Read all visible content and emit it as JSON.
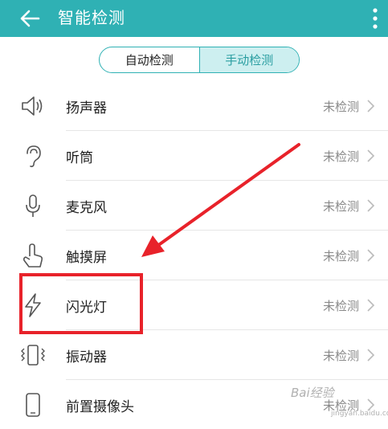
{
  "header": {
    "title": "智能检测",
    "bg_color": "#2fb1b4"
  },
  "segment": {
    "auto": "自动检测",
    "manual": "手动检测",
    "active": "manual"
  },
  "items": [
    {
      "label": "扬声器",
      "status": "未检测",
      "icon": "speaker-icon"
    },
    {
      "label": "听筒",
      "status": "未检测",
      "icon": "ear-icon"
    },
    {
      "label": "麦克风",
      "status": "未检测",
      "icon": "microphone-icon"
    },
    {
      "label": "触摸屏",
      "status": "未检测",
      "icon": "touch-icon"
    },
    {
      "label": "闪光灯",
      "status": "未检测",
      "icon": "flash-icon"
    },
    {
      "label": "振动器",
      "status": "未检测",
      "icon": "vibration-icon"
    },
    {
      "label": "前置摄像头",
      "status": "未检测",
      "icon": "phone-icon"
    }
  ],
  "annotation": {
    "highlight_color": "#e8222a"
  },
  "watermark": {
    "text": "Bai经验",
    "sub": "jingyan.baidu.com"
  }
}
